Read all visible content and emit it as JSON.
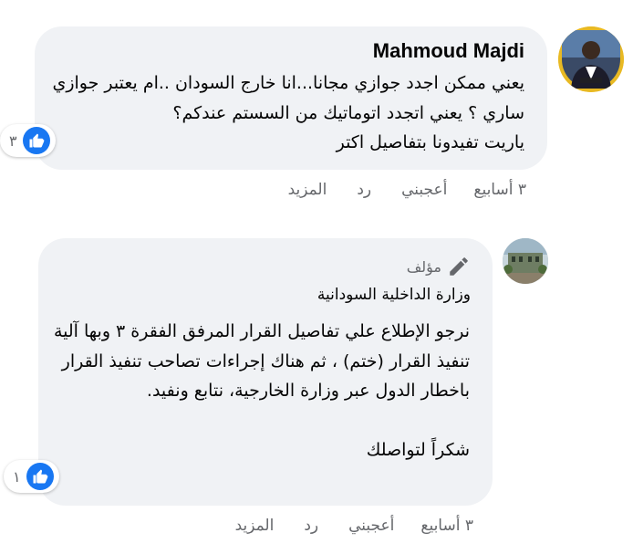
{
  "comments": [
    {
      "author": "Mahmoud Majdi",
      "text": "يعني ممكن اجدد جوازي مجانا...انا خارج السودان ..ام يعتبر جوازي ساري ؟ يعني اتجدد اتوماتيك من السستم عندكم؟\nياريت تفيدونا بتفاصيل اكتر",
      "reaction_count": "٣",
      "time": "٣ أسابيع",
      "like_label": "أعجبني",
      "reply_label": "رد",
      "more_label": "المزيد",
      "avatar_icon": "person-photo-icon"
    },
    {
      "author_badge": "مؤلف",
      "author": "وزارة الداخلية السودانية",
      "text": "نرجو الإطلاع علي تفاصيل القرار المرفق الفقرة ٣ وبها آلية تنفيذ القرار (ختم) ، ثم هناك إجراءات تصاحب تنفيذ القرار باخطار الدول عبر وزارة الخارجية، نتابع ونفيد.\n\nشكراً لتواصلك",
      "reaction_count": "١",
      "time": "٣ أسابيع",
      "like_label": "أعجبني",
      "reply_label": "رد",
      "more_label": "المزيد",
      "avatar_icon": "building-photo-icon"
    }
  ],
  "colors": {
    "bubble": "#f0f2f5",
    "like_blue": "#1877f2",
    "meta_text": "#65676b"
  }
}
